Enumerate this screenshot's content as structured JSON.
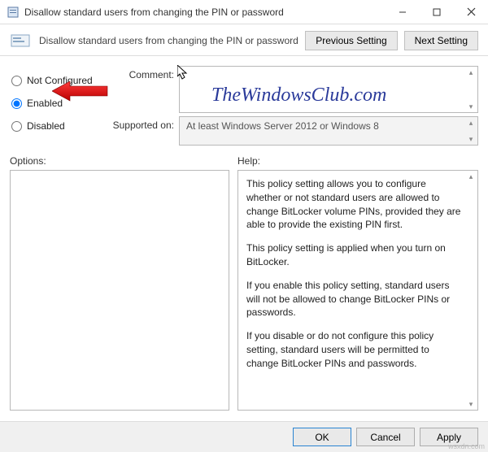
{
  "window": {
    "title": "Disallow standard users from changing the PIN or password"
  },
  "header": {
    "subtitle": "Disallow standard users from changing the PIN or password",
    "prev": "Previous Setting",
    "next": "Next Setting"
  },
  "radios": {
    "not_configured": "Not Configured",
    "enabled": "Enabled",
    "disabled": "Disabled",
    "selected": "enabled"
  },
  "fields": {
    "comment_label": "Comment:",
    "comment_value": "",
    "supported_label": "Supported on:",
    "supported_value": "At least Windows Server 2012 or Windows 8"
  },
  "sections": {
    "options": "Options:",
    "help": "Help:"
  },
  "help": {
    "p1": "This policy setting allows you to configure whether or not standard users are allowed to change BitLocker volume PINs, provided they are able to provide the existing PIN first.",
    "p2": "This policy setting is applied when you turn on BitLocker.",
    "p3": "If you enable this policy setting, standard users will not be allowed to change BitLocker PINs or passwords.",
    "p4": "If you disable or do not configure this policy setting, standard users will be permitted to change BitLocker PINs and passwords."
  },
  "buttons": {
    "ok": "OK",
    "cancel": "Cancel",
    "apply": "Apply"
  },
  "watermark": "TheWindowsClub.com",
  "corner": "wsxdn.com"
}
